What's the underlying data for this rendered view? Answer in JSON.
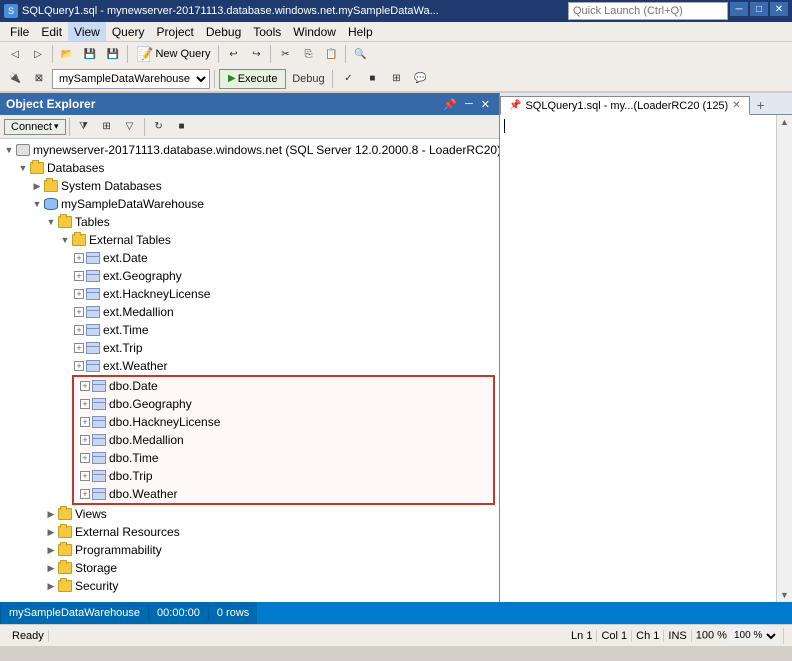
{
  "title": {
    "text": "SQLQuery1.sql - mynewserver-20171113.database.windows.net.mySampleDataWa...",
    "icon": "SQL"
  },
  "title_buttons": {
    "minimize": "─",
    "maximize": "□",
    "close": "✕"
  },
  "menu": {
    "items": [
      "File",
      "Edit",
      "View",
      "Query",
      "Project",
      "Debug",
      "Tools",
      "Window",
      "Help"
    ]
  },
  "toolbar": {
    "new_query_label": "New Query",
    "execute_label": "Execute",
    "debug_label": "Debug"
  },
  "query_toolbar": {
    "database": "mySampleDataWarehouse",
    "execute": "Execute",
    "debug": "Debug"
  },
  "quick_launch": {
    "placeholder": "Quick Launch (Ctrl+Q)"
  },
  "object_explorer": {
    "title": "Object Explorer",
    "connect_label": "Connect",
    "server": "mynewserver-20171113.database.windows.net (SQL Server 12.0.2000.8 - LoaderRC20)",
    "tree": [
      {
        "id": "databases",
        "label": "Databases",
        "indent": 1,
        "type": "folder",
        "state": "open"
      },
      {
        "id": "system-dbs",
        "label": "System Databases",
        "indent": 2,
        "type": "folder",
        "state": "closed"
      },
      {
        "id": "mysample",
        "label": "mySampleDataWarehouse",
        "indent": 2,
        "type": "db",
        "state": "open"
      },
      {
        "id": "tables",
        "label": "Tables",
        "indent": 3,
        "type": "folder",
        "state": "open"
      },
      {
        "id": "ext-tables",
        "label": "External Tables",
        "indent": 4,
        "type": "folder",
        "state": "open"
      },
      {
        "id": "ext-date",
        "label": "ext.Date",
        "indent": 5,
        "type": "table",
        "state": "closed"
      },
      {
        "id": "ext-geography",
        "label": "ext.Geography",
        "indent": 5,
        "type": "table",
        "state": "closed"
      },
      {
        "id": "ext-hackney",
        "label": "ext.HackneyLicense",
        "indent": 5,
        "type": "table",
        "state": "closed"
      },
      {
        "id": "ext-medallion",
        "label": "ext.Medallion",
        "indent": 5,
        "type": "table",
        "state": "closed"
      },
      {
        "id": "ext-time",
        "label": "ext.Time",
        "indent": 5,
        "type": "table",
        "state": "closed"
      },
      {
        "id": "ext-trip",
        "label": "ext.Trip",
        "indent": 5,
        "type": "table",
        "state": "closed"
      },
      {
        "id": "ext-weather",
        "label": "ext.Weather",
        "indent": 5,
        "type": "table",
        "state": "closed"
      }
    ],
    "highlighted_tables": [
      {
        "id": "dbo-date",
        "label": "dbo.Date",
        "type": "table",
        "state": "closed"
      },
      {
        "id": "dbo-geography",
        "label": "dbo.Geography",
        "type": "table",
        "state": "closed"
      },
      {
        "id": "dbo-hackney",
        "label": "dbo.HackneyLicense",
        "type": "table",
        "state": "closed"
      },
      {
        "id": "dbo-medallion",
        "label": "dbo.Medallion",
        "type": "table",
        "state": "closed"
      },
      {
        "id": "dbo-time",
        "label": "dbo.Time",
        "type": "table",
        "state": "closed"
      },
      {
        "id": "dbo-trip",
        "label": "dbo.Trip",
        "type": "table",
        "state": "closed"
      },
      {
        "id": "dbo-weather",
        "label": "dbo.Weather",
        "type": "table",
        "state": "closed"
      }
    ],
    "tree_bottom": [
      {
        "id": "views",
        "label": "Views",
        "indent": 3,
        "type": "folder",
        "state": "closed"
      },
      {
        "id": "ext-resources",
        "label": "External Resources",
        "indent": 3,
        "type": "folder",
        "state": "closed"
      },
      {
        "id": "programmability",
        "label": "Programmability",
        "indent": 3,
        "type": "folder",
        "state": "closed"
      },
      {
        "id": "storage",
        "label": "Storage",
        "indent": 3,
        "type": "folder",
        "state": "closed"
      },
      {
        "id": "security",
        "label": "Security",
        "indent": 3,
        "type": "folder",
        "state": "closed"
      }
    ]
  },
  "query_panel": {
    "tab_label": "SQLQuery1.sql - my...(LoaderRC20 (125)",
    "content": ""
  },
  "status_bar": {
    "db_name": "mySampleDataWarehouse",
    "time": "00:00:00",
    "rows": "0 rows"
  },
  "bottom_status": {
    "ready": "Ready",
    "ln": "Ln 1",
    "col": "Col 1",
    "ch": "Ch 1",
    "ins": "INS",
    "zoom": "100 %"
  }
}
